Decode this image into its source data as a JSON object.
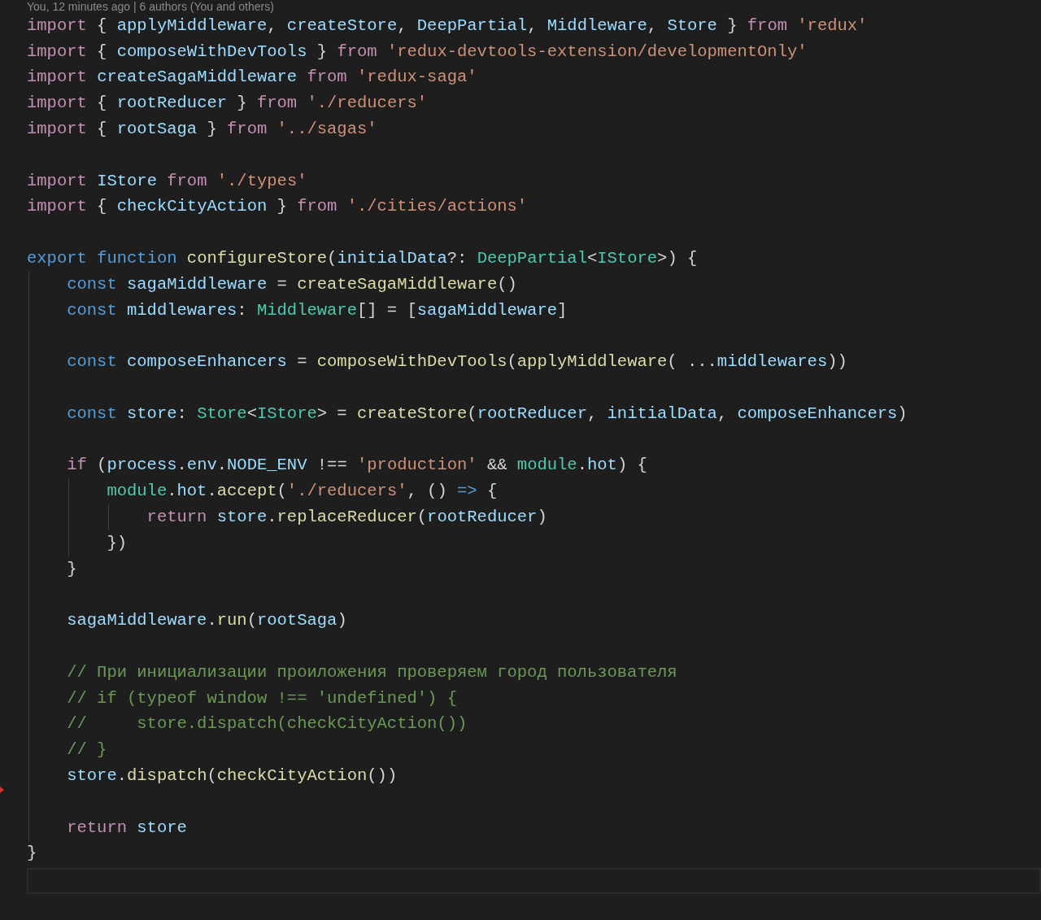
{
  "codelens": "You, 12 minutes ago | 6 authors (You and others)",
  "lines": [
    {
      "kind": "code",
      "tokens": [
        {
          "text": "import",
          "kind": "kw"
        },
        {
          "text": " { ",
          "kind": "p"
        },
        {
          "text": "applyMiddleware",
          "kind": "var"
        },
        {
          "text": ", ",
          "kind": "p"
        },
        {
          "text": "createStore",
          "kind": "var"
        },
        {
          "text": ", ",
          "kind": "p"
        },
        {
          "text": "DeepPartial",
          "kind": "var"
        },
        {
          "text": ", ",
          "kind": "p"
        },
        {
          "text": "Middleware",
          "kind": "var"
        },
        {
          "text": ", ",
          "kind": "p"
        },
        {
          "text": "Store",
          "kind": "var"
        },
        {
          "text": " } ",
          "kind": "p"
        },
        {
          "text": "from ",
          "kind": "kw"
        },
        {
          "text": "'redux'",
          "kind": "str"
        }
      ]
    },
    {
      "kind": "code",
      "tokens": [
        {
          "text": "import",
          "kind": "kw"
        },
        {
          "text": " { ",
          "kind": "p"
        },
        {
          "text": "composeWithDevTools",
          "kind": "var"
        },
        {
          "text": " } ",
          "kind": "p"
        },
        {
          "text": "from ",
          "kind": "kw"
        },
        {
          "text": "'redux-devtools-extension/developmentOnly'",
          "kind": "str"
        }
      ]
    },
    {
      "kind": "code",
      "tokens": [
        {
          "text": "import ",
          "kind": "kw"
        },
        {
          "text": "createSagaMiddleware ",
          "kind": "var"
        },
        {
          "text": "from ",
          "kind": "kw"
        },
        {
          "text": "'redux-saga'",
          "kind": "str"
        }
      ]
    },
    {
      "kind": "code",
      "tokens": [
        {
          "text": "import",
          "kind": "kw"
        },
        {
          "text": " { ",
          "kind": "p"
        },
        {
          "text": "rootReducer",
          "kind": "var"
        },
        {
          "text": " } ",
          "kind": "p"
        },
        {
          "text": "from ",
          "kind": "kw"
        },
        {
          "text": "'./reducers'",
          "kind": "str"
        }
      ]
    },
    {
      "kind": "code",
      "tokens": [
        {
          "text": "import",
          "kind": "kw"
        },
        {
          "text": " { ",
          "kind": "p"
        },
        {
          "text": "rootSaga",
          "kind": "var"
        },
        {
          "text": " } ",
          "kind": "p"
        },
        {
          "text": "from ",
          "kind": "kw"
        },
        {
          "text": "'../sagas'",
          "kind": "str"
        }
      ]
    },
    {
      "kind": "blank"
    },
    {
      "kind": "code",
      "tokens": [
        {
          "text": "import ",
          "kind": "kw"
        },
        {
          "text": "IStore ",
          "kind": "var"
        },
        {
          "text": "from ",
          "kind": "kw"
        },
        {
          "text": "'./types'",
          "kind": "str"
        }
      ]
    },
    {
      "kind": "code",
      "tokens": [
        {
          "text": "import",
          "kind": "kw"
        },
        {
          "text": " { ",
          "kind": "p"
        },
        {
          "text": "checkCityAction",
          "kind": "var"
        },
        {
          "text": " } ",
          "kind": "p"
        },
        {
          "text": "from ",
          "kind": "kw"
        },
        {
          "text": "'./cities/actions'",
          "kind": "str"
        }
      ]
    },
    {
      "kind": "blank"
    },
    {
      "kind": "code",
      "tokens": [
        {
          "text": "export ",
          "kind": "storage"
        },
        {
          "text": "function ",
          "kind": "storage"
        },
        {
          "text": "configureStore",
          "kind": "fn"
        },
        {
          "text": "(",
          "kind": "p"
        },
        {
          "text": "initialData",
          "kind": "var"
        },
        {
          "text": "?: ",
          "kind": "p"
        },
        {
          "text": "DeepPartial",
          "kind": "type"
        },
        {
          "text": "<",
          "kind": "p"
        },
        {
          "text": "IStore",
          "kind": "type"
        },
        {
          "text": ">) {",
          "kind": "p"
        }
      ],
      "children": [
        {
          "kind": "code",
          "tokens": [
            {
              "text": "const ",
              "kind": "storage"
            },
            {
              "text": "sagaMiddleware",
              "kind": "var"
            },
            {
              "text": " = ",
              "kind": "p"
            },
            {
              "text": "createSagaMiddleware",
              "kind": "fn"
            },
            {
              "text": "()",
              "kind": "p"
            }
          ]
        },
        {
          "kind": "code",
          "tokens": [
            {
              "text": "const ",
              "kind": "storage"
            },
            {
              "text": "middlewares",
              "kind": "var"
            },
            {
              "text": ": ",
              "kind": "p"
            },
            {
              "text": "Middleware",
              "kind": "type"
            },
            {
              "text": "[] = [",
              "kind": "p"
            },
            {
              "text": "sagaMiddleware",
              "kind": "var"
            },
            {
              "text": "]",
              "kind": "p"
            }
          ]
        },
        {
          "kind": "blank"
        },
        {
          "kind": "code",
          "tokens": [
            {
              "text": "const ",
              "kind": "storage"
            },
            {
              "text": "composeEnhancers",
              "kind": "var"
            },
            {
              "text": " = ",
              "kind": "p"
            },
            {
              "text": "composeWithDevTools",
              "kind": "fn"
            },
            {
              "text": "(",
              "kind": "p"
            },
            {
              "text": "applyMiddleware",
              "kind": "fn"
            },
            {
              "text": "( ...",
              "kind": "p"
            },
            {
              "text": "middlewares",
              "kind": "var"
            },
            {
              "text": "))",
              "kind": "p"
            }
          ]
        },
        {
          "kind": "blank"
        },
        {
          "kind": "code",
          "tokens": [
            {
              "text": "const ",
              "kind": "storage"
            },
            {
              "text": "store",
              "kind": "var"
            },
            {
              "text": ": ",
              "kind": "p"
            },
            {
              "text": "Store",
              "kind": "type"
            },
            {
              "text": "<",
              "kind": "p"
            },
            {
              "text": "IStore",
              "kind": "type"
            },
            {
              "text": "> = ",
              "kind": "p"
            },
            {
              "text": "createStore",
              "kind": "fn"
            },
            {
              "text": "(",
              "kind": "p"
            },
            {
              "text": "rootReducer",
              "kind": "var"
            },
            {
              "text": ", ",
              "kind": "p"
            },
            {
              "text": "initialData",
              "kind": "var"
            },
            {
              "text": ", ",
              "kind": "p"
            },
            {
              "text": "composeEnhancers",
              "kind": "var"
            },
            {
              "text": ")",
              "kind": "p"
            }
          ]
        },
        {
          "kind": "blank"
        },
        {
          "kind": "code",
          "tokens": [
            {
              "text": "if",
              "kind": "kw"
            },
            {
              "text": " (",
              "kind": "p"
            },
            {
              "text": "process",
              "kind": "var"
            },
            {
              "text": ".",
              "kind": "p"
            },
            {
              "text": "env",
              "kind": "var"
            },
            {
              "text": ".",
              "kind": "p"
            },
            {
              "text": "NODE_ENV",
              "kind": "var"
            },
            {
              "text": " !== ",
              "kind": "p"
            },
            {
              "text": "'production'",
              "kind": "str"
            },
            {
              "text": " && ",
              "kind": "p"
            },
            {
              "text": "module",
              "kind": "type"
            },
            {
              "text": ".",
              "kind": "p"
            },
            {
              "text": "hot",
              "kind": "var"
            },
            {
              "text": ") {",
              "kind": "p"
            }
          ],
          "children": [
            {
              "kind": "code",
              "tokens": [
                {
                  "text": "module",
                  "kind": "type"
                },
                {
                  "text": ".",
                  "kind": "p"
                },
                {
                  "text": "hot",
                  "kind": "var"
                },
                {
                  "text": ".",
                  "kind": "p"
                },
                {
                  "text": "accept",
                  "kind": "fn"
                },
                {
                  "text": "(",
                  "kind": "p"
                },
                {
                  "text": "'./reducers'",
                  "kind": "str"
                },
                {
                  "text": ", () ",
                  "kind": "p"
                },
                {
                  "text": "=>",
                  "kind": "storage"
                },
                {
                  "text": " {",
                  "kind": "p"
                }
              ],
              "children": [
                {
                  "kind": "code",
                  "tokens": [
                    {
                      "text": "return ",
                      "kind": "kw"
                    },
                    {
                      "text": "store",
                      "kind": "var"
                    },
                    {
                      "text": ".",
                      "kind": "p"
                    },
                    {
                      "text": "replaceReducer",
                      "kind": "fn"
                    },
                    {
                      "text": "(",
                      "kind": "p"
                    },
                    {
                      "text": "rootReducer",
                      "kind": "var"
                    },
                    {
                      "text": ")",
                      "kind": "p"
                    }
                  ]
                }
              ]
            },
            {
              "kind": "code",
              "tokens": [
                {
                  "text": "})",
                  "kind": "p"
                }
              ]
            }
          ]
        },
        {
          "kind": "code",
          "tokens": [
            {
              "text": "}",
              "kind": "p"
            }
          ]
        },
        {
          "kind": "blank"
        },
        {
          "kind": "code",
          "tokens": [
            {
              "text": "sagaMiddleware",
              "kind": "var"
            },
            {
              "text": ".",
              "kind": "p"
            },
            {
              "text": "run",
              "kind": "fn"
            },
            {
              "text": "(",
              "kind": "p"
            },
            {
              "text": "rootSaga",
              "kind": "var"
            },
            {
              "text": ")",
              "kind": "p"
            }
          ]
        },
        {
          "kind": "blank"
        },
        {
          "kind": "code",
          "tokens": [
            {
              "text": "// При инициализации проиложения проверяем город пользователя",
              "kind": "comment"
            }
          ]
        },
        {
          "kind": "code",
          "tokens": [
            {
              "text": "// if (typeof window !== 'undefined') {",
              "kind": "comment"
            }
          ]
        },
        {
          "kind": "code",
          "tokens": [
            {
              "text": "//     store.dispatch(checkCityAction())",
              "kind": "comment"
            }
          ]
        },
        {
          "kind": "code",
          "tokens": [
            {
              "text": "// }",
              "kind": "comment"
            }
          ]
        },
        {
          "kind": "code",
          "tokens": [
            {
              "text": "store",
              "kind": "var"
            },
            {
              "text": ".",
              "kind": "p"
            },
            {
              "text": "dispatch",
              "kind": "fn"
            },
            {
              "text": "(",
              "kind": "p"
            },
            {
              "text": "checkCityAction",
              "kind": "fn"
            },
            {
              "text": "())",
              "kind": "p"
            }
          ],
          "deleted_below": true
        },
        {
          "kind": "blank"
        },
        {
          "kind": "code",
          "tokens": [
            {
              "text": "return ",
              "kind": "kw"
            },
            {
              "text": "store",
              "kind": "var"
            }
          ]
        }
      ]
    },
    {
      "kind": "code",
      "tokens": [
        {
          "text": "}",
          "kind": "p"
        }
      ]
    },
    {
      "kind": "current"
    }
  ]
}
